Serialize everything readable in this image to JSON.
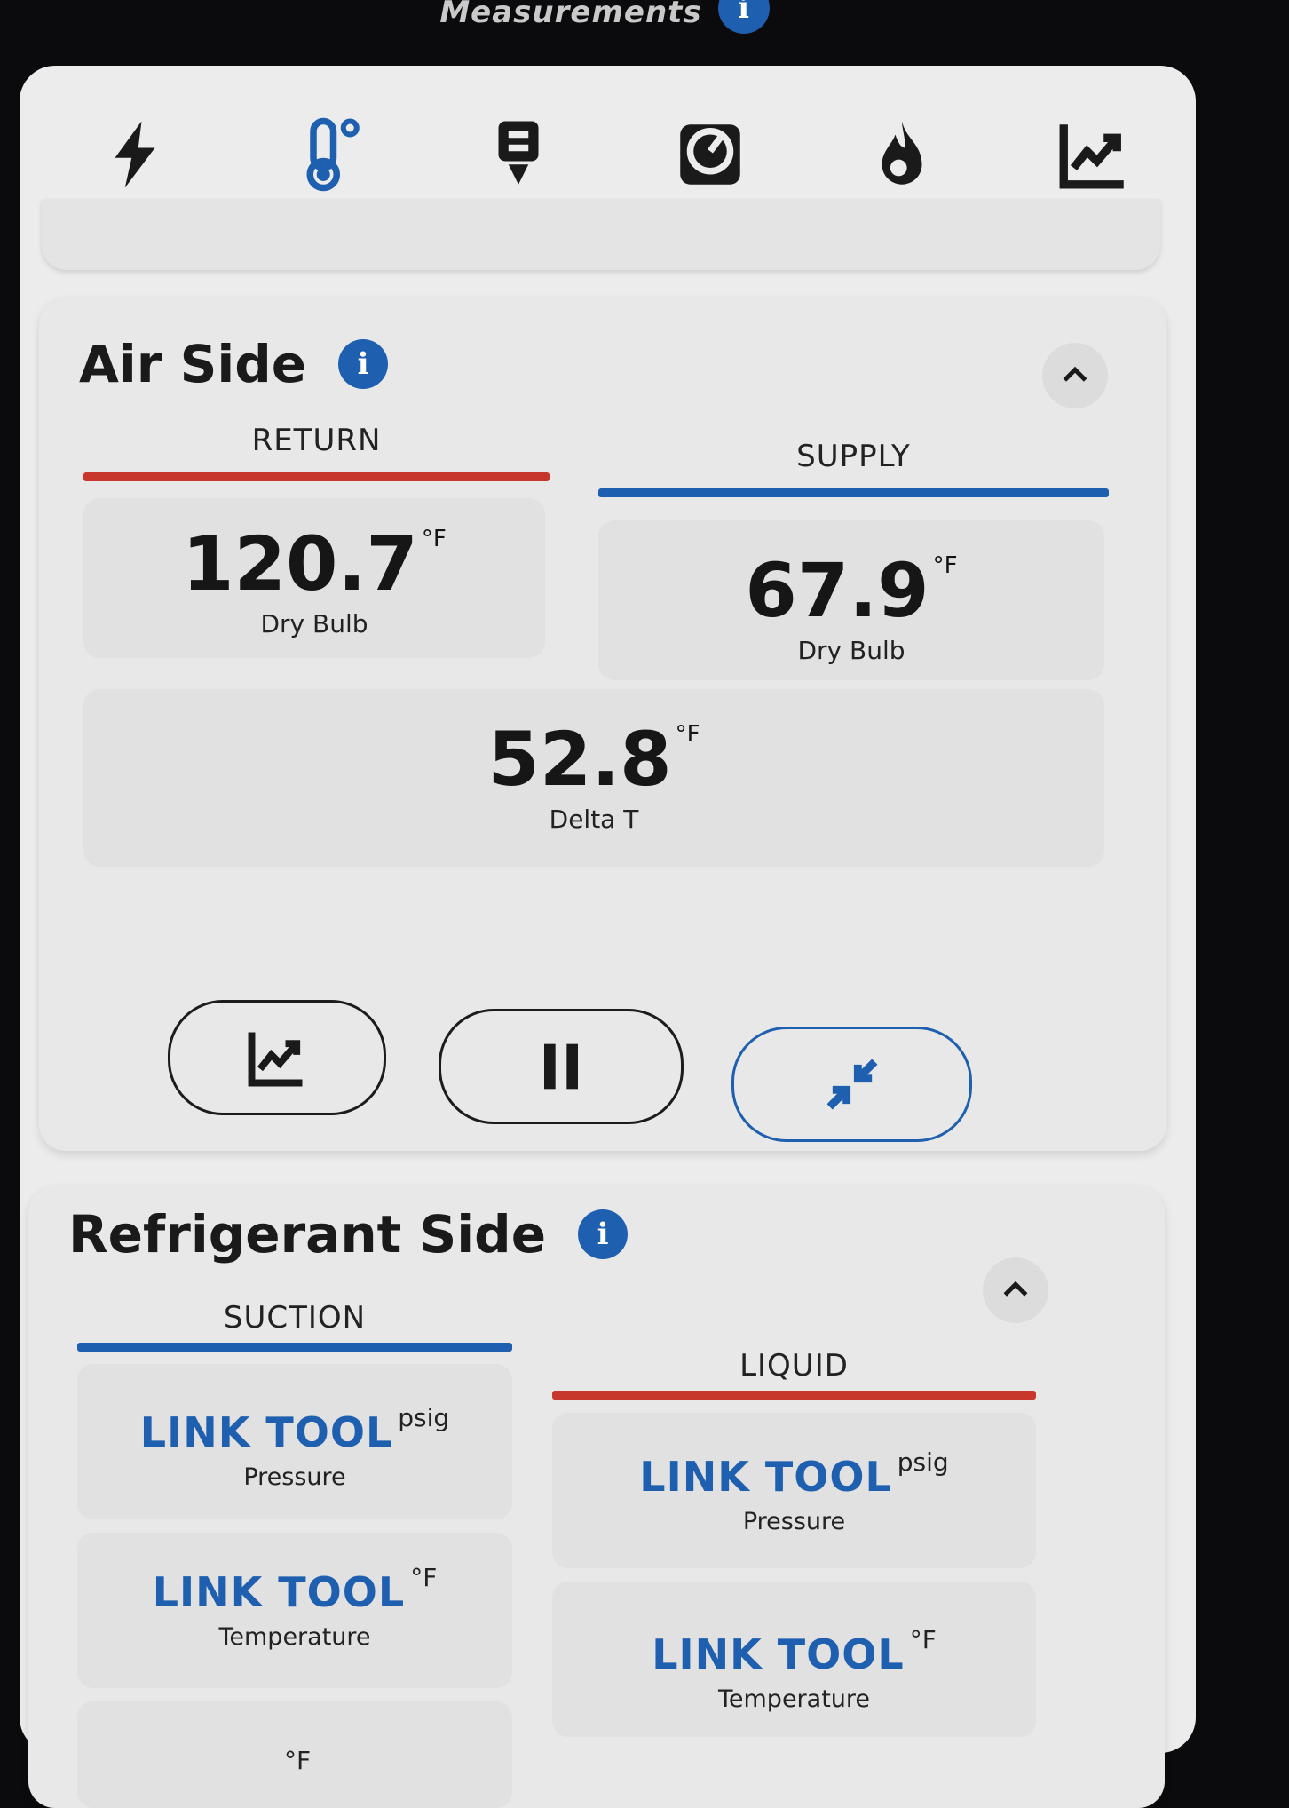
{
  "header": {
    "title": "Measurements",
    "info": "i"
  },
  "toolbar": {
    "icons": [
      "lightning-icon",
      "thermometer-icon",
      "probe-icon",
      "gauge-icon",
      "flame-icon",
      "chart-icon"
    ],
    "active_color": "#1a1a1a"
  },
  "air_side": {
    "title": "Air Side",
    "info": "i",
    "return": {
      "header": "RETURN",
      "value": "120.7",
      "unit": "°F",
      "label": "Dry Bulb",
      "color": "#c8372b"
    },
    "supply": {
      "header": "SUPPLY",
      "value": "67.9",
      "unit": "°F",
      "label": "Dry Bulb",
      "color": "#1f5fb0"
    },
    "delta": {
      "value": "52.8",
      "unit": "°F",
      "label": "Delta T"
    }
  },
  "refrigerant_side": {
    "title": "Refrigerant Side",
    "info": "i",
    "suction": {
      "header": "SUCTION",
      "pressure": {
        "value": "LINK TOOL",
        "unit": "psig",
        "label": "Pressure"
      },
      "temperature": {
        "value": "LINK TOOL",
        "unit": "°F",
        "label": "Temperature"
      },
      "partial_unit": "°F"
    },
    "liquid": {
      "header": "LIQUID",
      "pressure": {
        "value": "LINK TOOL",
        "unit": "psig",
        "label": "Pressure"
      },
      "temperature": {
        "value": "LINK TOOL",
        "unit": "°F",
        "label": "Temperature"
      }
    }
  },
  "colors": {
    "accent_blue": "#1f5fb0",
    "accent_red": "#c8372b",
    "background": "#ececec"
  }
}
